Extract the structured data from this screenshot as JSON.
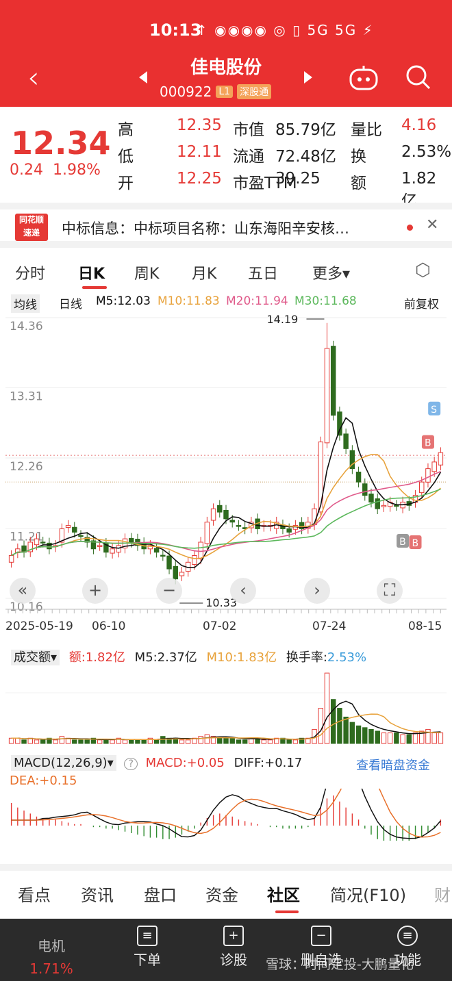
{
  "status": {
    "time": "10:13",
    "icons": "↑ ◉◉◉◉  ◎ ▯ 5G 5G ⚡"
  },
  "header": {
    "title": "佳电股份",
    "code": "000922",
    "level": "L1",
    "market": "深股通"
  },
  "quote": {
    "price": "12.34",
    "change": "0.24",
    "change_pct": "1.98%",
    "rows": [
      {
        "l1": "高",
        "v1": "12.35",
        "l2": "市值",
        "v2": "85.79亿",
        "l3": "量比",
        "v3": "4.16"
      },
      {
        "l1": "低",
        "v1": "12.11",
        "l2": "流通",
        "v2": "72.48亿",
        "l3": "换",
        "v3": "2.53%"
      },
      {
        "l1": "开",
        "v1": "12.25",
        "l2": "市盈TTM",
        "v2": "39.25",
        "l3": "额",
        "v3": "1.82亿"
      }
    ]
  },
  "news": {
    "logo_top": "同花顺",
    "logo_bottom": "速递",
    "text": "中标信息：中标项目名称：山东海阳辛安核…"
  },
  "tabs": [
    "分时",
    "日K",
    "周K",
    "月K",
    "五日",
    "更多▾"
  ],
  "ma": {
    "type": "均线",
    "period": "日线",
    "m5": "M5:12.03",
    "m10": "M10:11.83",
    "m20": "M20:11.94",
    "m30": "M30:11.68",
    "adjust": "前复权"
  },
  "chart_data": [
    {
      "type": "candlestick",
      "title": "日K",
      "y_ticks": [
        "14.36",
        "13.31",
        "12.26",
        "11.21",
        "10.16"
      ],
      "x_ticks": [
        "2025-05-19",
        "06-10",
        "07-02",
        "07-24",
        "08-15"
      ],
      "high_label": "14.19",
      "low_label": "10.33",
      "ylim": [
        10.16,
        14.36
      ],
      "closes": [
        10.8,
        10.9,
        10.85,
        11.0,
        11.05,
        11.0,
        10.9,
        10.95,
        11.2,
        11.25,
        11.15,
        11.1,
        11.0,
        10.9,
        10.95,
        10.85,
        10.9,
        10.95,
        11.05,
        11.0,
        10.95,
        10.9,
        10.95,
        10.85,
        10.8,
        10.6,
        10.45,
        10.55,
        10.7,
        10.8,
        11.0,
        11.3,
        11.5,
        11.45,
        11.35,
        11.3,
        11.25,
        11.2,
        11.3,
        11.2,
        11.25,
        11.25,
        11.3,
        11.2,
        11.15,
        11.25,
        11.2,
        11.3,
        11.5,
        12.5,
        13.9,
        12.9,
        12.6,
        12.4,
        12.1,
        11.9,
        11.7,
        11.6,
        11.5,
        11.55,
        11.6,
        11.55,
        11.6,
        11.55,
        11.7,
        11.9,
        12.1,
        12.2,
        12.34
      ],
      "series": [
        {
          "name": "M5",
          "color": "#111111"
        },
        {
          "name": "M10",
          "color": "#e8a33d"
        },
        {
          "name": "M20",
          "color": "#e05a8a"
        },
        {
          "name": "M30",
          "color": "#5cb85c"
        }
      ],
      "markers": [
        "S",
        "B",
        "B",
        "B"
      ]
    },
    {
      "type": "bar",
      "title": "成交额",
      "values": [
        3,
        3,
        2,
        3,
        2,
        2,
        3,
        2,
        4,
        3,
        2,
        2,
        2,
        3,
        2,
        2,
        2,
        3,
        2,
        2,
        2,
        2,
        3,
        2,
        4,
        3,
        3,
        2,
        2,
        3,
        4,
        5,
        4,
        3,
        3,
        3,
        2,
        2,
        3,
        3,
        2,
        2,
        3,
        3,
        2,
        2,
        3,
        3,
        8,
        20,
        40,
        25,
        20,
        15,
        12,
        10,
        9,
        8,
        7,
        6,
        6,
        6,
        5,
        5,
        6,
        7,
        8,
        6,
        6
      ]
    },
    {
      "type": "bar",
      "title": "MACD",
      "values": [
        0.15,
        0.12,
        0.1,
        0.08,
        0.06,
        0.05,
        0.04,
        0.04,
        0.03,
        0.02,
        0.01,
        0.01,
        0.0,
        -0.01,
        -0.01,
        -0.02,
        -0.02,
        -0.03,
        -0.04,
        -0.05,
        -0.06,
        -0.07,
        -0.08,
        -0.08,
        -0.09,
        -0.09,
        -0.08,
        -0.06,
        -0.04,
        -0.02,
        0.02,
        0.05,
        0.07,
        0.08,
        0.07,
        0.06,
        0.04,
        0.03,
        0.02,
        0.01,
        0.0,
        -0.01,
        -0.01,
        -0.02,
        -0.02,
        -0.02,
        -0.02,
        -0.01,
        0.05,
        0.12,
        0.18,
        0.2,
        0.16,
        0.12,
        0.08,
        0.04,
        -0.02,
        -0.06,
        -0.09,
        -0.1,
        -0.1,
        -0.1,
        -0.1,
        -0.1,
        -0.09,
        -0.07,
        -0.05,
        -0.02,
        0.04
      ]
    }
  ],
  "volume": {
    "label": "成交额▾",
    "amount": "额:1.82亿",
    "m5": "M5:2.37亿",
    "m10": "M10:1.83亿",
    "turnover_label": "换手率:",
    "turnover": "2.53%"
  },
  "macd": {
    "label": "MACD(12,26,9)▾",
    "help": "?",
    "macd": "MACD:+0.05",
    "diff": "DIFF:+0.17",
    "dea": "DEA:+0.15",
    "link": "查看暗盘资金"
  },
  "bottom_tabs": [
    "看点",
    "资讯",
    "盘口",
    "资金",
    "社区",
    "简况(F10)",
    "财"
  ],
  "footer": {
    "sector": "电机",
    "sector_pct": "1.71%",
    "items": [
      "下单",
      "诊股",
      "删自选",
      "功能"
    ]
  },
  "watermark": "雪球：时间定投-大鹏量化",
  "colors": {
    "up": "#e53935",
    "down": "#2e6b1e",
    "accent": "#e93030"
  }
}
